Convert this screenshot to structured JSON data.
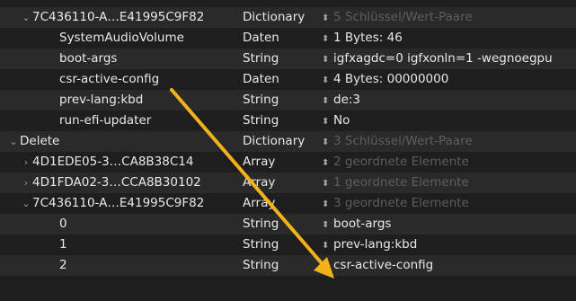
{
  "plist": {
    "rows": [
      {
        "key": "7C436110-A…E41995C9F82",
        "type": "Dictionary",
        "value": "5 Schlüssel/Wert-Paare",
        "dim": true,
        "depth": 1,
        "chevron": "⌄"
      },
      {
        "key": "SystemAudioVolume",
        "type": "Daten",
        "value": "1 Bytes: 46",
        "dim": false,
        "depth": 2,
        "chevron": ""
      },
      {
        "key": "boot-args",
        "type": "String",
        "value": "igfxagdc=0 igfxonln=1 -wegnoegpu",
        "dim": false,
        "depth": 2,
        "chevron": ""
      },
      {
        "key": "csr-active-config",
        "type": "Daten",
        "value": "4 Bytes: 00000000",
        "dim": false,
        "depth": 2,
        "chevron": ""
      },
      {
        "key": "prev-lang:kbd",
        "type": "String",
        "value": "de:3",
        "dim": false,
        "depth": 2,
        "chevron": ""
      },
      {
        "key": "run-efi-updater",
        "type": "String",
        "value": "No",
        "dim": false,
        "depth": 2,
        "chevron": ""
      },
      {
        "key": "Delete",
        "type": "Dictionary",
        "value": "3 Schlüssel/Wert-Paare",
        "dim": true,
        "depth": 0,
        "chevron": "⌄"
      },
      {
        "key": "4D1EDE05-3…CA8B38C14",
        "type": "Array",
        "value": "2 geordnete Elemente",
        "dim": true,
        "depth": 1,
        "chevron": "›"
      },
      {
        "key": "4D1FDA02-3…CCA8B30102",
        "type": "Array",
        "value": "1 geordnete Elemente",
        "dim": true,
        "depth": 1,
        "chevron": "›"
      },
      {
        "key": "7C436110-A…E41995C9F82",
        "type": "Array",
        "value": "3 geordnete Elemente",
        "dim": true,
        "depth": 1,
        "chevron": "⌄"
      },
      {
        "key": "0",
        "type": "String",
        "value": "boot-args",
        "dim": false,
        "depth": 2,
        "chevron": ""
      },
      {
        "key": "1",
        "type": "String",
        "value": "prev-lang:kbd",
        "dim": false,
        "depth": 2,
        "chevron": ""
      },
      {
        "key": "2",
        "type": "String",
        "value": "csr-active-config",
        "dim": false,
        "depth": 2,
        "chevron": ""
      }
    ]
  },
  "icons": {
    "stepper": "stepper-updown-icon",
    "expanded": "chevron-down-icon",
    "collapsed": "chevron-right-icon",
    "annotation": "annotation-arrow-icon"
  },
  "colors": {
    "background": "#1e1e1e",
    "row_alt": "#2a2a2a",
    "text": "#e8e8e8",
    "dim_text": "#5e5e5e",
    "arrow": "#f2b21a"
  }
}
